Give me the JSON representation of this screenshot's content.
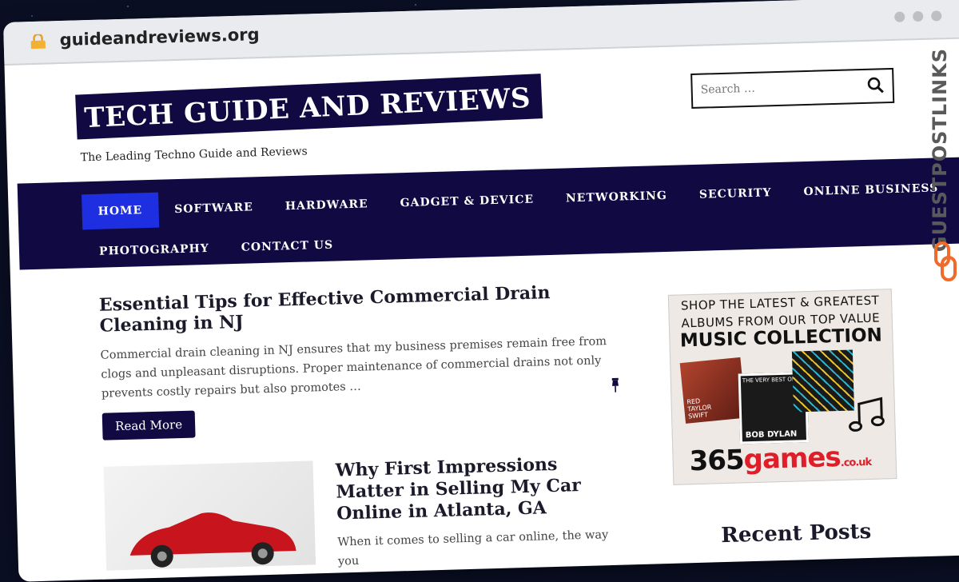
{
  "browser": {
    "url": "guideandreviews.org"
  },
  "site": {
    "title": "TECH GUIDE AND REVIEWS",
    "tagline": "The Leading Techno Guide and Reviews",
    "search_placeholder": "Search …"
  },
  "nav": {
    "row1": [
      "HOME",
      "SOFTWARE",
      "HARDWARE",
      "GADGET & DEVICE",
      "NETWORKING",
      "SECURITY",
      "ONLINE BUSINESS"
    ],
    "row2": [
      "PHOTOGRAPHY",
      "CONTACT US"
    ],
    "active": "HOME"
  },
  "posts": [
    {
      "title": "Essential Tips for Effective Commercial Drain Cleaning in NJ",
      "excerpt": "Commercial drain cleaning in NJ ensures that my business premises remain free from clogs and unpleasant disruptions. Proper maintenance of commercial drains not only prevents costly repairs but also promotes …",
      "read_more": "Read More"
    },
    {
      "title": "Why First Impressions Matter in Selling My Car Online in Atlanta, GA",
      "excerpt": "When it comes to selling a car online, the way you"
    }
  ],
  "ad": {
    "line1a": "SHOP THE LATEST & GREATEST",
    "line1b": "ALBUMS FROM OUR TOP VALUE",
    "line2": "MUSIC COLLECTION",
    "cover1": "RED TAYLOR SWIFT",
    "cover2_top": "THE VERY BEST OF",
    "cover2_bottom": "BOB DYLAN",
    "brand_num": "365",
    "brand_word": "games",
    "brand_tld": ".co.uk"
  },
  "sidebar": {
    "recent_posts": "Recent Posts"
  },
  "watermark": {
    "text": "GUESTPOSTLINKS"
  },
  "colors": {
    "nav_bg": "#110a42",
    "active_nav": "#1d2fe0"
  }
}
